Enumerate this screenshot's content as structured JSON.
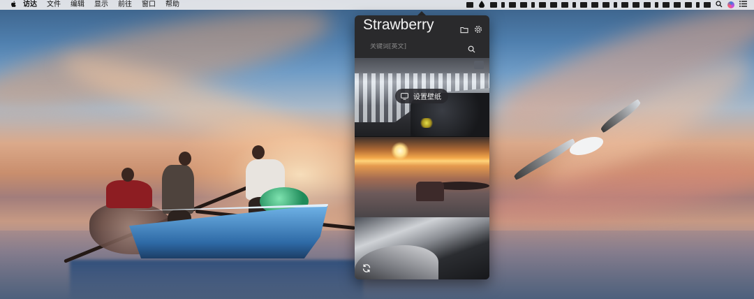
{
  "menubar": {
    "apple_icon": "apple-icon",
    "items": [
      "访达",
      "文件",
      "编辑",
      "显示",
      "前往",
      "窗口",
      "帮助"
    ]
  },
  "status_bar": {
    "icons": [
      "drop-icon",
      "spotlight-search-icon",
      "siri-icon",
      "notification-center-icon"
    ]
  },
  "popover": {
    "title": "Strawberry",
    "header_icons": [
      "folder-icon",
      "gear-icon"
    ],
    "search": {
      "placeholder": "关键词[英文]",
      "value": ""
    },
    "set_wallpaper_label": "设置壁纸",
    "wallpapers": [
      {
        "name": "waterfall-rocks"
      },
      {
        "name": "sunrise-fog-castle"
      },
      {
        "name": "snowy-forest-valley"
      }
    ],
    "refresh_icon": "refresh-icon",
    "background_color": "#2a2a2c"
  }
}
